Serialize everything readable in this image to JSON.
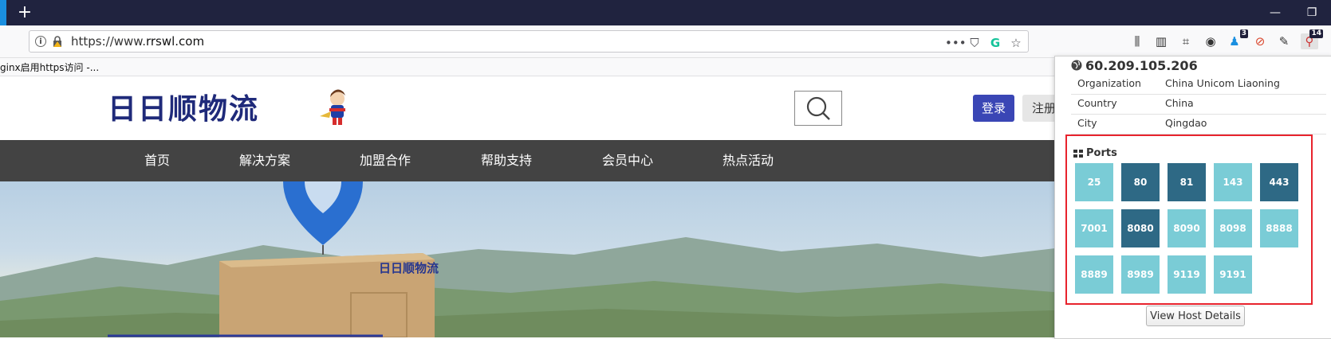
{
  "browser": {
    "new_tab_label": "+",
    "minimize_label": "—",
    "restore_label": "❐",
    "url_prefix": "https://www.",
    "url_host": "rrswl.com",
    "page_actions": {
      "more": "•••",
      "pocket": "⛉",
      "grammarly": "G",
      "bookmark_star": "☆"
    },
    "bookmark_item": "ginx启用https访问 -...",
    "toolbar_badges": {
      "notifications": "3",
      "shodan": "14"
    }
  },
  "site": {
    "logo_text": "日日顺物流",
    "login_label": "登录",
    "register_label": "注册",
    "menu": [
      "首页",
      "解决方案",
      "加盟合作",
      "帮助支持",
      "会员中心",
      "热点活动"
    ],
    "box_brand": "日日顺物流",
    "colors": {
      "menu_bg": "#434343",
      "login_bg": "#3a46b5",
      "logo": "#1f2a7a"
    }
  },
  "popup": {
    "ip": "60.209.105.206",
    "info": [
      {
        "label": "Organization",
        "value": "China Unicom Liaoning"
      },
      {
        "label": "Country",
        "value": "China"
      },
      {
        "label": "City",
        "value": "Qingdao"
      }
    ],
    "ports_title": "Ports",
    "ports": [
      {
        "port": "25",
        "style": "light"
      },
      {
        "port": "80",
        "style": "dark"
      },
      {
        "port": "81",
        "style": "dark"
      },
      {
        "port": "143",
        "style": "light"
      },
      {
        "port": "443",
        "style": "dark"
      },
      {
        "port": "7001",
        "style": "light"
      },
      {
        "port": "8080",
        "style": "dark"
      },
      {
        "port": "8090",
        "style": "light"
      },
      {
        "port": "8098",
        "style": "light"
      },
      {
        "port": "8888",
        "style": "light"
      },
      {
        "port": "8889",
        "style": "light"
      },
      {
        "port": "8989",
        "style": "light"
      },
      {
        "port": "9119",
        "style": "light"
      },
      {
        "port": "9191",
        "style": "light"
      }
    ],
    "view_button": "View Host Details",
    "colors": {
      "port_light": "#7accd6",
      "port_dark": "#2e6985",
      "highlight_border": "#e8232d"
    }
  }
}
